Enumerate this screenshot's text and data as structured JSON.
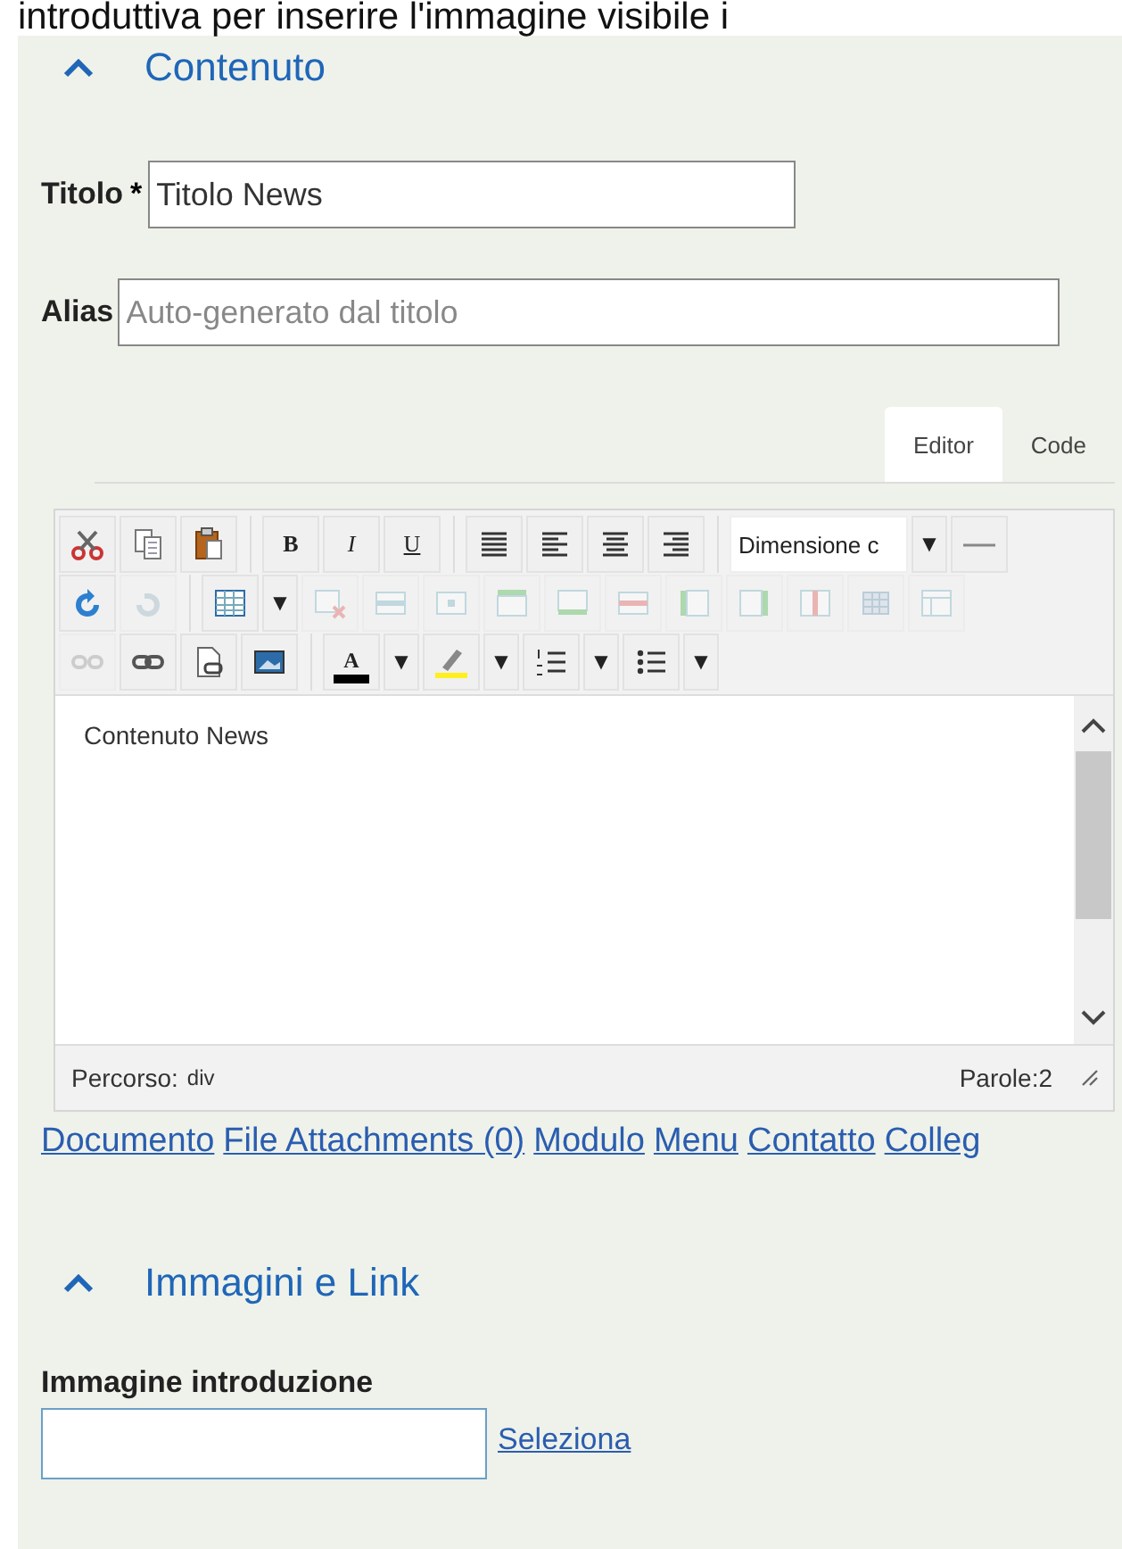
{
  "intro_text": "introduttiva per inserire l'immagine visibile i",
  "sections": [
    {
      "title": "Contenuto",
      "expanded": true
    },
    {
      "title": "Immagini e Link",
      "expanded": true
    }
  ],
  "fields": [
    {
      "label": "Titolo",
      "required_mark": "*",
      "value": "Titolo News"
    },
    {
      "label": "Alias",
      "placeholder": "Auto-generato dal titolo"
    }
  ],
  "editor": {
    "tabs": [
      {
        "label": "Editor",
        "selected": true
      },
      {
        "label": "Code",
        "selected": false
      }
    ],
    "toolbar": [
      [
        [
          {
            "kind": "icon",
            "disabled": false
          },
          {
            "kind": "icon",
            "disabled": false
          },
          {
            "kind": "icon",
            "disabled": false
          }
        ],
        [
          {
            "kind": "text",
            "label": "B"
          },
          {
            "kind": "text",
            "label": "I"
          },
          {
            "kind": "text",
            "label": "U"
          }
        ],
        [
          {
            "kind": "icon",
            "disabled": false
          },
          {
            "kind": "icon",
            "disabled": false
          },
          {
            "kind": "icon",
            "disabled": false
          },
          {
            "kind": "icon",
            "disabled": false
          }
        ],
        [
          {
            "kind": "select",
            "label": "Dimensione c"
          },
          {
            "kind": "arrow",
            "label": "▼"
          },
          {
            "kind": "icon",
            "disabled": false
          }
        ]
      ],
      [
        [
          {
            "kind": "icon",
            "disabled": false
          },
          {
            "kind": "icon",
            "disabled": true
          }
        ],
        [
          {
            "kind": "icon",
            "disabled": false
          },
          {
            "kind": "arrow",
            "label": "▼"
          },
          {
            "kind": "icon",
            "disabled": true
          },
          {
            "kind": "icon",
            "disabled": true
          },
          {
            "kind": "icon",
            "disabled": true
          },
          {
            "kind": "icon",
            "disabled": true
          },
          {
            "kind": "icon",
            "disabled": true
          },
          {
            "kind": "icon",
            "disabled": true
          },
          {
            "kind": "icon",
            "disabled": true
          },
          {
            "kind": "icon",
            "disabled": true
          },
          {
            "kind": "icon",
            "disabled": true
          },
          {
            "kind": "icon",
            "disabled": true
          },
          {
            "kind": "icon",
            "disabled": true
          }
        ]
      ],
      [
        [
          {
            "kind": "icon",
            "disabled": true
          },
          {
            "kind": "icon",
            "disabled": false
          },
          {
            "kind": "icon",
            "disabled": false
          },
          {
            "kind": "icon",
            "disabled": false
          }
        ],
        [
          {
            "kind": "textcolor",
            "label": "A"
          },
          {
            "kind": "arrow",
            "label": "▼"
          },
          {
            "kind": "icon",
            "disabled": false
          },
          {
            "kind": "arrow",
            "label": "▼"
          },
          {
            "kind": "icon",
            "disabled": false
          },
          {
            "kind": "arrow",
            "label": "▼"
          },
          {
            "kind": "icon",
            "disabled": false
          },
          {
            "kind": "arrow",
            "label": "▼"
          }
        ]
      ]
    ],
    "content": "Contenuto News",
    "path_label": "Percorso:",
    "path_value": "div",
    "word_count": "Parole:2"
  },
  "editor_buttons": [
    "Documento",
    "File Attachments (0)",
    "Modulo",
    "Menu",
    "Contatto",
    "Colleg"
  ],
  "image_field": {
    "label": "Immagine introduzione",
    "button": "Seleziona"
  }
}
